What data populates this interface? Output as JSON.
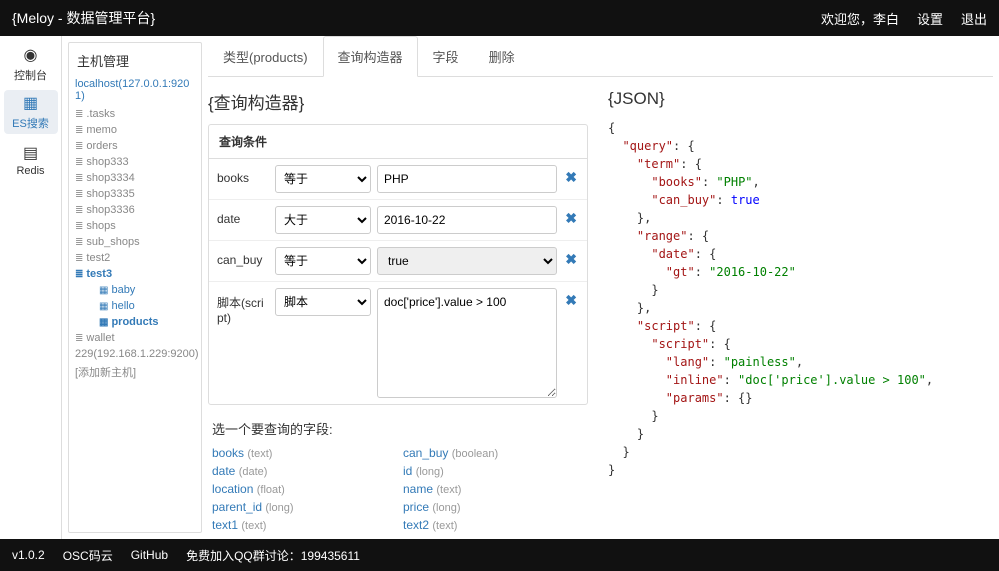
{
  "topbar": {
    "title": "{Meloy - 数据管理平台}",
    "welcome": "欢迎您，李白",
    "settings": "设置",
    "logout": "退出"
  },
  "leftnav": {
    "console": "控制台",
    "es": "ES搜索",
    "redis": "Redis"
  },
  "sidebar": {
    "title": "主机管理",
    "host1": "localhost(127.0.0.1:9201)",
    "items": [
      ".tasks",
      "memo",
      "orders",
      "shop333",
      "shop3334",
      "shop3335",
      "shop3336",
      "shops",
      "sub_shops",
      "test2"
    ],
    "test3": "test3",
    "sub_test3": [
      "baby",
      "hello"
    ],
    "products": "products",
    "wallet": "wallet",
    "host2": "229(192.168.1.229:9200)",
    "addhost": "[添加新主机]"
  },
  "tabs": {
    "type": "类型(products)",
    "builder": "查询构造器",
    "fields": "字段",
    "delete": "删除"
  },
  "builder": {
    "title": "{查询构造器}",
    "panel_header": "查询条件",
    "rows": [
      {
        "label": "books",
        "op": "等于",
        "val": "PHP",
        "kind": "input"
      },
      {
        "label": "date",
        "op": "大于",
        "val": "2016-10-22",
        "kind": "input"
      },
      {
        "label": "can_buy",
        "op": "等于",
        "val": "true",
        "kind": "select"
      },
      {
        "label": "脚本(script)",
        "op": "脚本",
        "val": "doc['price'].value > 100",
        "kind": "textarea"
      }
    ],
    "fields_title": "选一个要查询的字段:",
    "field_list": [
      {
        "name": "books",
        "type": "(text)"
      },
      {
        "name": "can_buy",
        "type": "(boolean)"
      },
      {
        "name": "date",
        "type": "(date)"
      },
      {
        "name": "id",
        "type": "(long)"
      },
      {
        "name": "location",
        "type": "(float)"
      },
      {
        "name": "name",
        "type": "(text)"
      },
      {
        "name": "parent_id",
        "type": "(long)"
      },
      {
        "name": "price",
        "type": "(long)"
      },
      {
        "name": "text1",
        "type": "(text)"
      },
      {
        "name": "text2",
        "type": "(text)"
      }
    ]
  },
  "json": {
    "title": "{JSON}",
    "query": {
      "term": {
        "books": "PHP",
        "can_buy": true
      },
      "range": {
        "date": {
          "gt": "2016-10-22"
        }
      },
      "script": {
        "script": {
          "lang": "painless",
          "inline": "doc['price'].value > 100",
          "params": {}
        }
      }
    }
  },
  "footer": {
    "version": "v1.0.2",
    "osc": "OSC码云",
    "github": "GitHub",
    "qq": "免费加入QQ群讨论：199435611"
  }
}
